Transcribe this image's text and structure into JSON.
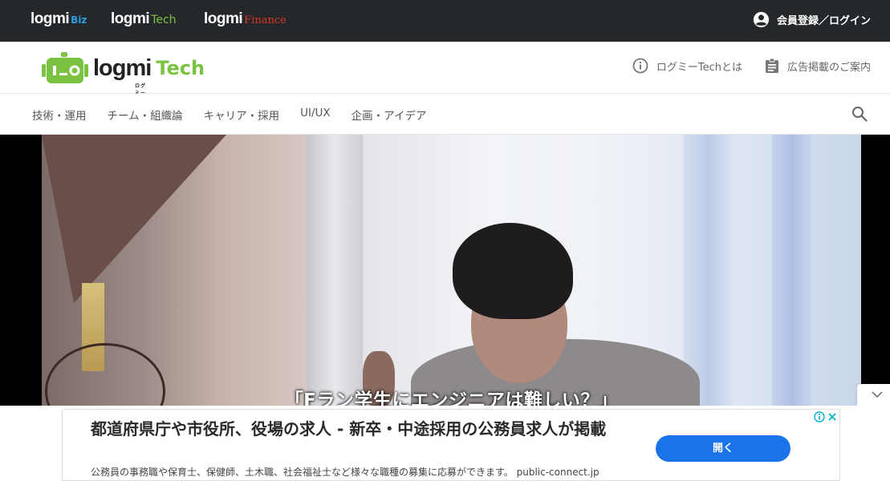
{
  "network_bar": {
    "brands": [
      {
        "name": "logmi",
        "sub": "Biz"
      },
      {
        "name": "logmi",
        "sub": "Tech"
      },
      {
        "name": "logmi",
        "sub": "Finance"
      }
    ],
    "login_label": "会員登録／ログイン",
    "login_icon": "account-circle-icon"
  },
  "header": {
    "logo_name": "logmi",
    "logo_kana": "ログミー",
    "logo_sub": "Tech",
    "links": [
      {
        "label": "ログミーTechとは",
        "icon": "info-icon"
      },
      {
        "label": "広告掲載のご案内",
        "icon": "clipboard-icon"
      }
    ]
  },
  "categories": [
    "技術・運用",
    "チーム・組織論",
    "キャリア・採用",
    "UI/UX",
    "企画・アイデア"
  ],
  "search_icon": "search-icon",
  "hero": {
    "caption": "「Fラン学生にエンジニアは難しい？」"
  },
  "ad": {
    "title": "都道府県庁や市役所、役場の求人 - 新卒・中途採用の公務員求人が掲載",
    "description": "公務員の事務職や保育士、保健師、土木職、社会福祉士など様々な職種の募集に応募ができます。 public-connect.jp",
    "cta": "開く",
    "adchoices_icon": "adchoices-icon",
    "close_icon": "close-icon"
  },
  "colors": {
    "topbar": "#25282b",
    "tech_green": "#7cc242",
    "biz_blue": "#2e9de0",
    "finance_red": "#d9362b",
    "cta_blue": "#1a73e8"
  }
}
